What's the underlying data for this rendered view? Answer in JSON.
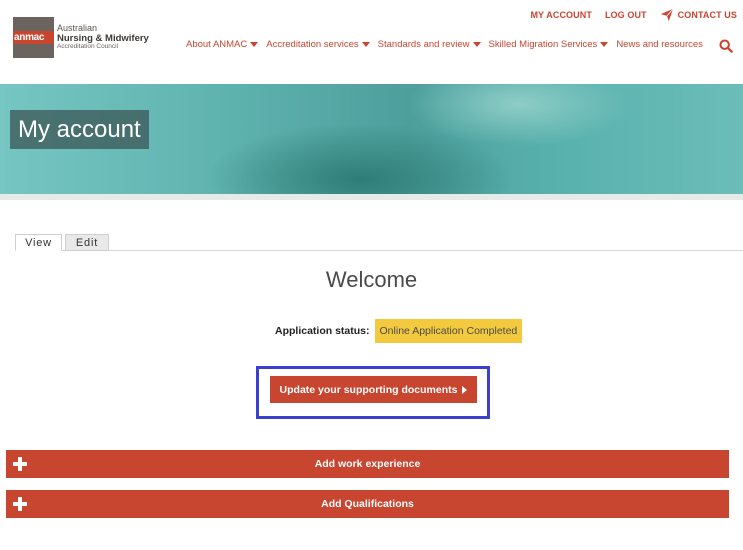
{
  "header": {
    "top_links": {
      "my_account": "MY ACCOUNT",
      "log_out": "LOG OUT",
      "contact_us": "CONTACT US"
    },
    "logo": {
      "mark": "anmac",
      "line1": "Australian",
      "line2": "Nursing & Midwifery",
      "line3": "Accreditation Council"
    },
    "nav": [
      {
        "label": "About ANMAC",
        "has_dropdown": true
      },
      {
        "label": "Accreditation services",
        "has_dropdown": true
      },
      {
        "label": "Standards and review",
        "has_dropdown": true
      },
      {
        "label": "Skilled Migration Services",
        "has_dropdown": true
      },
      {
        "label": "News and resources",
        "has_dropdown": false
      }
    ],
    "icons": {
      "contact": "send-icon",
      "search": "search-icon"
    }
  },
  "hero": {
    "title": "My account"
  },
  "tabs": [
    {
      "label": "View",
      "active": true
    },
    {
      "label": "Edit",
      "active": false
    }
  ],
  "main": {
    "heading": "Welcome",
    "status_label": "Application status:",
    "status_value": "Online Application Completed",
    "update_button": "Update your supporting documents"
  },
  "accordions": [
    {
      "label": "Add work experience",
      "icon": "plus-icon"
    },
    {
      "label": "Add Qualifications",
      "icon": "plus-icon"
    }
  ],
  "colors": {
    "brand_red": "#c8452f",
    "status_yellow": "#f3ca3e",
    "highlight_blue": "#3a3ed1",
    "logo_gray": "#6b635e"
  }
}
